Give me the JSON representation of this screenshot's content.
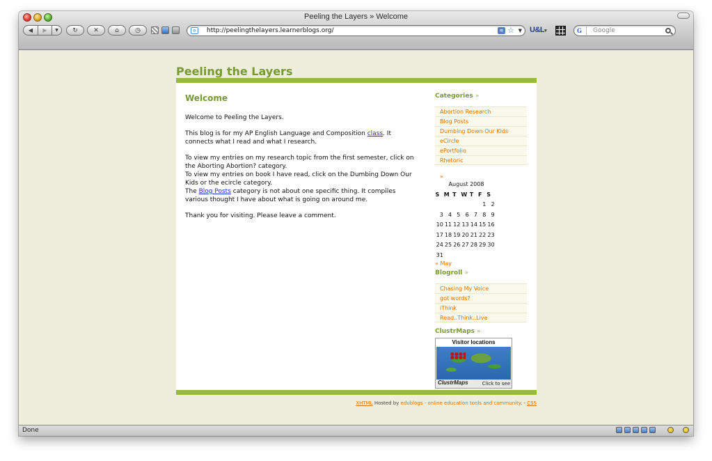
{
  "window": {
    "title": "Peeling the Layers » Welcome"
  },
  "toolbar": {
    "back_glyph": "◀",
    "forward_glyph": "▶",
    "history_glyph": "▼",
    "reload_glyph": "↻",
    "stop_glyph": "✕",
    "home_glyph": "⌂",
    "clock_glyph": "◷",
    "url": "http://peelingthelayers.learnerblogs.org/",
    "rss_glyph": "≋",
    "star_glyph": "☆",
    "url_dropdown_glyph": "▼",
    "addon_logo": "U&L",
    "addon_logo_arrow": "▾",
    "search_engine_glyph": "G",
    "search_placeholder": "Google"
  },
  "page": {
    "blog_title": "Peeling the Layers",
    "post": {
      "title": "Welcome",
      "p1": "Welcome to Peeling the Layers.",
      "p2_before": "This blog is for my AP English Language and Composition ",
      "p2_link": "class",
      "p2_after": ". It connects what I read and what I research.",
      "p3_line1": "To view my entries on my research topic from the first semester, click on the Aborting Abortion? category.",
      "p3_line2": "To view my entries on book I have read, click on the Dumbing Down Our Kids or the ecircle category.",
      "p3_line3_before": "The ",
      "p3_line3_link": "Blog Posts",
      "p3_line3_after": " category is not about one specific thing. It compiles various thought I have about what is going on around me.",
      "p4": "Thank you for visiting. Please leave a comment."
    },
    "sidebar": {
      "categories_heading": "Categories",
      "heading_arrow": "»",
      "categories": [
        "Abortion Research",
        "Blog Posts",
        "Dumbing Down Our Kids",
        "eCircle",
        "ePortfolio",
        "Rhetoric"
      ],
      "calendar_arrow": "»",
      "calendar": {
        "caption": "August 2008",
        "weekdays": [
          "S",
          "M",
          "T",
          "W",
          "T",
          "F",
          "S"
        ],
        "weeks": [
          [
            "",
            "",
            "",
            "",
            "",
            "1",
            "2"
          ],
          [
            "3",
            "4",
            "5",
            "6",
            "7",
            "8",
            "9"
          ],
          [
            "10",
            "11",
            "12",
            "13",
            "14",
            "15",
            "16"
          ],
          [
            "17",
            "18",
            "19",
            "20",
            "21",
            "22",
            "23"
          ],
          [
            "24",
            "25",
            "26",
            "27",
            "28",
            "29",
            "30"
          ],
          [
            "31",
            "",
            "",
            "",
            "",
            "",
            ""
          ]
        ],
        "prev_link": "« May"
      },
      "blogroll_heading": "Blogroll",
      "blogroll": [
        "Chasing My Voice",
        "got words?",
        "iThink",
        "Read..Think..Live"
      ],
      "clustrmaps_heading": "ClustrMaps",
      "map_header": "Visitor locations",
      "map_logo": "ClustrMaps",
      "map_footer": "Click to see"
    },
    "footer": {
      "xhtml": "XHTML",
      "hosted_by": " Hosted by ",
      "host": "edublogs - online education tools and community",
      "sep": ". - ",
      "css": "CSS"
    }
  },
  "status": {
    "text": "Done"
  },
  "colors": {
    "accent_green": "#98ba3a",
    "title_green": "#799a30",
    "link_orange": "#e07000",
    "page_bg": "#eeeedc"
  }
}
